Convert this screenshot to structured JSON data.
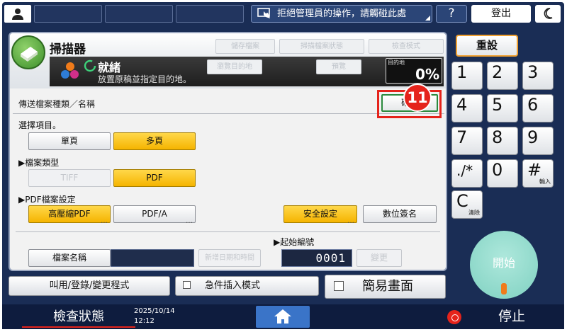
{
  "topbar": {
    "reject_label": "拒絕管理員的操作，請觸碰此處",
    "help_label": "?",
    "logout_label": "登出"
  },
  "app": {
    "title": "掃描器",
    "header_buttons": [
      "儲存檔案",
      "掃描檔案狀態",
      "檢查模式"
    ],
    "dest_list_label": "瀏覽目的地",
    "preview_label": "預覽",
    "status_title": "就緒",
    "status_message": "放置原稿並指定目的地。",
    "dest_counter_label": "目的地",
    "dest_counter_value": "0%",
    "step_badge": "11"
  },
  "form": {
    "section_title": "傳送檔案種類／名稱",
    "ok_label": "確定",
    "select_prompt": "選擇項目。",
    "page_options": [
      "單頁",
      "多頁"
    ],
    "page_selected": "多頁",
    "file_type_label": "▶檔案類型",
    "file_types": [
      "TIFF",
      "PDF"
    ],
    "file_type_selected": "PDF",
    "pdf_settings_label": "▶PDF檔案設定",
    "pdf_options": [
      "高壓縮PDF",
      "PDF/A"
    ],
    "pdf_selected": "高壓縮PDF",
    "security_label": "安全設定",
    "digital_sign_label": "數位簽名",
    "start_no_label": "▶起始編號",
    "file_name_label": "檔案名稱",
    "add_datetime_label": "新增日期和時間",
    "start_no_value": "0001",
    "change_label": "變更"
  },
  "bottom": {
    "program_label": "叫用/登錄/變更程式",
    "interrupt_label": "急件插入模式",
    "simple_screen_label": "簡易畫面"
  },
  "keypad": {
    "reset_label": "重設",
    "keys": [
      {
        "d": "1",
        "sub": ""
      },
      {
        "d": "2",
        "sub": ""
      },
      {
        "d": "3",
        "sub": ""
      },
      {
        "d": "4",
        "sub": ""
      },
      {
        "d": "5",
        "sub": ""
      },
      {
        "d": "6",
        "sub": ""
      },
      {
        "d": "7",
        "sub": ""
      },
      {
        "d": "8",
        "sub": ""
      },
      {
        "d": "9",
        "sub": ""
      },
      {
        "d": "./*",
        "sub": ""
      },
      {
        "d": "0",
        "sub": ""
      },
      {
        "d": "#",
        "sub": "輸入"
      },
      {
        "d": "C",
        "sub": "清除"
      }
    ],
    "start_label": "開始"
  },
  "statusbar": {
    "check_status_label": "檢查狀態",
    "date": "2025/10/14",
    "time": "12:12",
    "stop_label": "停止"
  },
  "colors": {
    "frame": "#1a2d55",
    "selected": "#f5b400",
    "highlight_red": "#e5231b",
    "ok_green": "#2c8a3e",
    "start_teal": "#7fd1c1"
  }
}
